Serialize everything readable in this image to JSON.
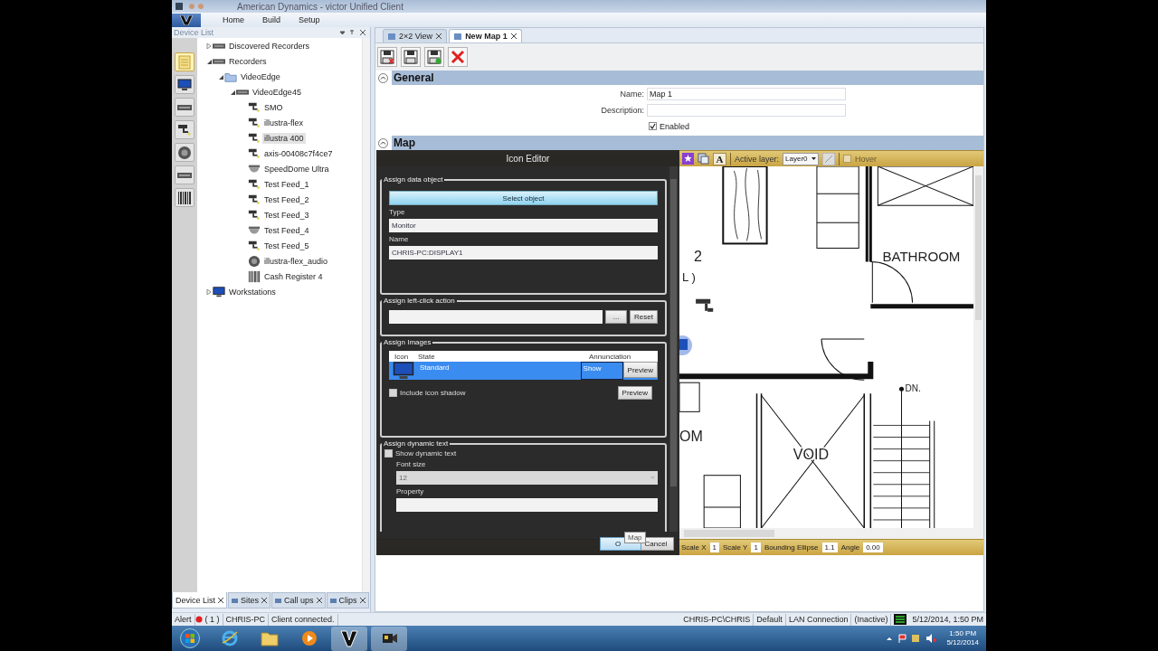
{
  "window": {
    "title": "American Dynamics - victor Unified Client"
  },
  "menu": [
    "Home",
    "Build",
    "Setup"
  ],
  "device_list": {
    "title": "Device List",
    "tool_strip": [
      {
        "kind": "notes",
        "selected": true
      },
      {
        "kind": "workstation",
        "selected": false
      },
      {
        "kind": "recorder",
        "selected": false
      },
      {
        "kind": "camera",
        "selected": false
      },
      {
        "kind": "speaker",
        "selected": false
      },
      {
        "kind": "recorder",
        "selected": false
      },
      {
        "kind": "register",
        "selected": false
      }
    ],
    "tree": [
      {
        "label": "Discovered Recorders",
        "kind": "recorder",
        "expanded": false,
        "selected": false
      },
      {
        "label": "Recorders",
        "kind": "recorder",
        "expanded": true,
        "selected": false,
        "children": [
          {
            "label": "VideoEdge",
            "kind": "folder",
            "expanded": true,
            "selected": false,
            "children": [
              {
                "label": "VideoEdge45",
                "kind": "recorder",
                "expanded": true,
                "selected": false,
                "children": [
                  {
                    "label": "SMO",
                    "kind": "camera",
                    "selected": false
                  },
                  {
                    "label": "illustra-flex",
                    "kind": "camera",
                    "selected": false
                  },
                  {
                    "label": "illustra 400",
                    "kind": "camera",
                    "selected": true
                  },
                  {
                    "label": "axis-00408c7f4ce7",
                    "kind": "camera",
                    "selected": false
                  },
                  {
                    "label": "SpeedDome Ultra",
                    "kind": "dome",
                    "selected": false
                  },
                  {
                    "label": "Test Feed_1",
                    "kind": "camera",
                    "selected": false
                  },
                  {
                    "label": "Test Feed_2",
                    "kind": "camera",
                    "selected": false
                  },
                  {
                    "label": "Test Feed_3",
                    "kind": "camera",
                    "selected": false
                  },
                  {
                    "label": "Test Feed_4",
                    "kind": "dome",
                    "selected": false
                  },
                  {
                    "label": "Test Feed_5",
                    "kind": "camera",
                    "selected": false
                  },
                  {
                    "label": "illustra-flex_audio",
                    "kind": "speaker",
                    "selected": false
                  },
                  {
                    "label": "Cash Register 4",
                    "kind": "register",
                    "selected": false
                  }
                ]
              }
            ]
          }
        ]
      },
      {
        "label": "Workstations",
        "kind": "workstation",
        "expanded": false,
        "selected": false
      }
    ]
  },
  "bottom_tabs": [
    {
      "label": "Device List",
      "selected": true
    },
    {
      "label": "Sites",
      "selected": false
    },
    {
      "label": "Call ups",
      "selected": false
    },
    {
      "label": "Clips",
      "selected": false
    }
  ],
  "doc_tabs": [
    {
      "label": "2×2 View",
      "selected": false
    },
    {
      "label": "New Map 1",
      "selected": true
    }
  ],
  "general": {
    "title": "General",
    "fields": [
      {
        "label": "Name:",
        "value": "Map 1"
      },
      {
        "label": "Description:"
      }
    ],
    "enabled": {
      "label": "Enabled",
      "checked": true
    }
  },
  "map": {
    "title": "Map",
    "toolbar": {
      "letter": "A",
      "layer_label": "Active layer:",
      "layer": "Layer0",
      "hover": {
        "label": "Hover",
        "checked": false
      }
    },
    "labels": [
      "2",
      "L )",
      "BATHROOM",
      "OM",
      "VOID",
      "DN."
    ],
    "properties": [
      {
        "label": "Scale X",
        "value": "1"
      },
      {
        "label": "Scale Y",
        "value": "1"
      },
      {
        "label": "Bounding Ellipse",
        "value": "1.1"
      },
      {
        "label": "Angle",
        "value": "0.00"
      }
    ]
  },
  "icon_editor": {
    "title": "Icon Editor",
    "data_object": {
      "title": "Assign data object",
      "select_button": "Select object",
      "type_label": "Type",
      "type": "Monitor",
      "name_label": "Name",
      "name": "CHRIS-PC:DISPLAY1"
    },
    "left_click": {
      "title": "Assign left-click action",
      "browse": "...",
      "reset": "Reset"
    },
    "images": {
      "title": "Assign Images",
      "columns": [
        "Icon",
        "State",
        "Annunciation"
      ],
      "rows": [
        {
          "state": "Standard",
          "annunciation": "Show",
          "preview": "Preview",
          "selected": true
        }
      ],
      "shadow": {
        "label": "Include icon shadow",
        "checked": false
      },
      "preview": "Preview"
    },
    "dynamic_text": {
      "title": "Assign dynamic text",
      "show": {
        "label": "Show dynamic text",
        "checked": false
      },
      "font_size_label": "Font size",
      "font_size": "12",
      "property_label": "Property"
    },
    "ok": "O",
    "tooltip": "Map",
    "cancel": "Cancel"
  },
  "status_bar": {
    "alert": "Alert",
    "alert_count": "( 1 )",
    "left": [
      "CHRIS-PC",
      "Client connected."
    ],
    "right": [
      "CHRIS-PC\\CHRIS",
      "Default",
      "LAN Connection",
      "(Inactive)"
    ],
    "datetime": "5/12/2014, 1:50 PM"
  },
  "taskbar": {
    "time": "1:50 PM",
    "date": "5/12/2014"
  }
}
